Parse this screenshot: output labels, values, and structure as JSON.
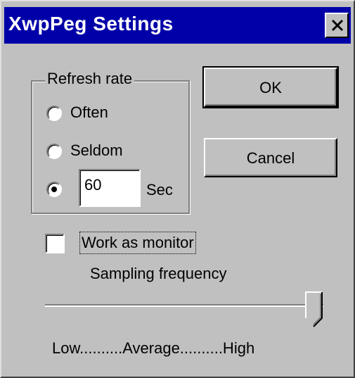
{
  "window": {
    "title": "XwpPeg Settings"
  },
  "refresh_group": {
    "label": "Refresh rate",
    "options": [
      {
        "label": "Often",
        "selected": false
      },
      {
        "label": "Seldom",
        "selected": false
      }
    ],
    "custom": {
      "selected": true,
      "value": "60",
      "unit": "Sec"
    }
  },
  "buttons": {
    "ok": "OK",
    "cancel": "Cancel"
  },
  "monitor": {
    "label": "Work as monitor",
    "checked": false
  },
  "sampling": {
    "label": "Sampling frequency",
    "scale_label": "Low..........Average..........High",
    "level": "High"
  }
}
